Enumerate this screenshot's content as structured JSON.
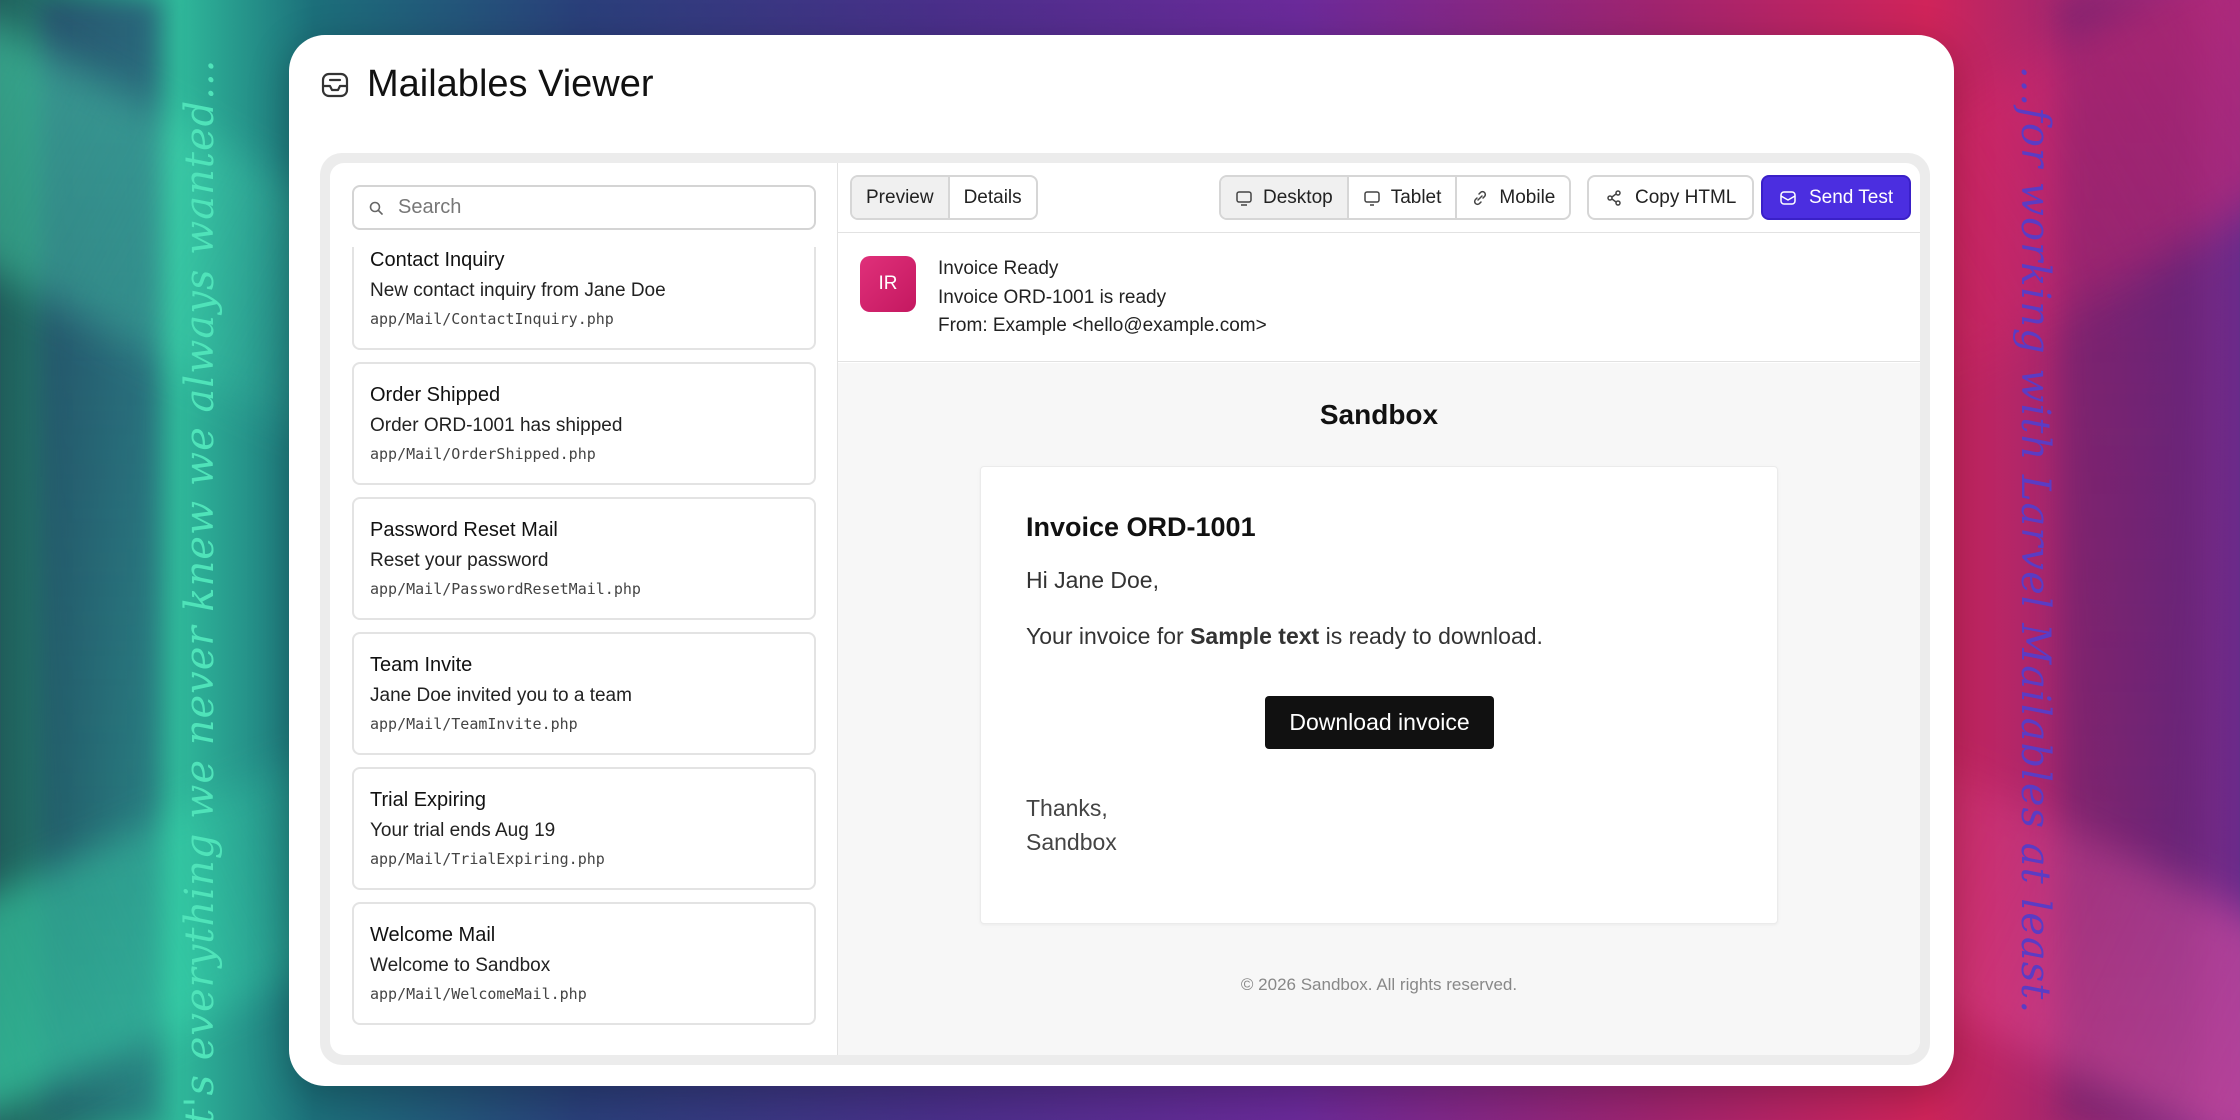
{
  "background": {
    "left_tagline": "It's everything we never knew we always wanted...",
    "right_tagline": "...for working with Larvel Mailables at least."
  },
  "app": {
    "title": "Mailables Viewer",
    "icon": "inbox-icon"
  },
  "sidebar": {
    "search_placeholder": "Search",
    "items": [
      {
        "title": "Contact Inquiry",
        "subject": "New contact inquiry from Jane Doe",
        "path": "app/Mail/ContactInquiry.php"
      },
      {
        "title": "Order Shipped",
        "subject": "Order ORD-1001 has shipped",
        "path": "app/Mail/OrderShipped.php"
      },
      {
        "title": "Password Reset Mail",
        "subject": "Reset your password",
        "path": "app/Mail/PasswordResetMail.php"
      },
      {
        "title": "Team Invite",
        "subject": "Jane Doe invited you to a team",
        "path": "app/Mail/TeamInvite.php"
      },
      {
        "title": "Trial Expiring",
        "subject": "Your trial ends Aug 19",
        "path": "app/Mail/TrialExpiring.php"
      },
      {
        "title": "Welcome Mail",
        "subject": "Welcome to Sandbox",
        "path": "app/Mail/WelcomeMail.php"
      }
    ]
  },
  "toolbar": {
    "tabs": [
      {
        "label": "Preview",
        "active": true
      },
      {
        "label": "Details",
        "active": false
      }
    ],
    "devices": [
      {
        "label": "Desktop",
        "icon": "monitor-icon",
        "active": true
      },
      {
        "label": "Tablet",
        "icon": "tablet-icon",
        "active": false
      },
      {
        "label": "Mobile",
        "icon": "mobile-icon",
        "active": false
      }
    ],
    "copy_html": "Copy HTML",
    "send_test": "Send Test",
    "accent_color": "#4b2ee0"
  },
  "meta": {
    "avatar_initials": "IR",
    "avatar_color": "#d6246e",
    "name": "Invoice Ready",
    "subject": "Invoice ORD-1001 is ready",
    "from": "From: Example <hello@example.com>"
  },
  "email": {
    "brand": "Sandbox",
    "heading": "Invoice ORD-1001",
    "greeting": "Hi Jane Doe,",
    "body_prefix": "Your invoice for ",
    "body_bold": "Sample text",
    "body_suffix": " is ready to download.",
    "button": "Download invoice",
    "thanks": "Thanks,",
    "signature": "Sandbox",
    "footer": "© 2026 Sandbox. All rights reserved."
  }
}
